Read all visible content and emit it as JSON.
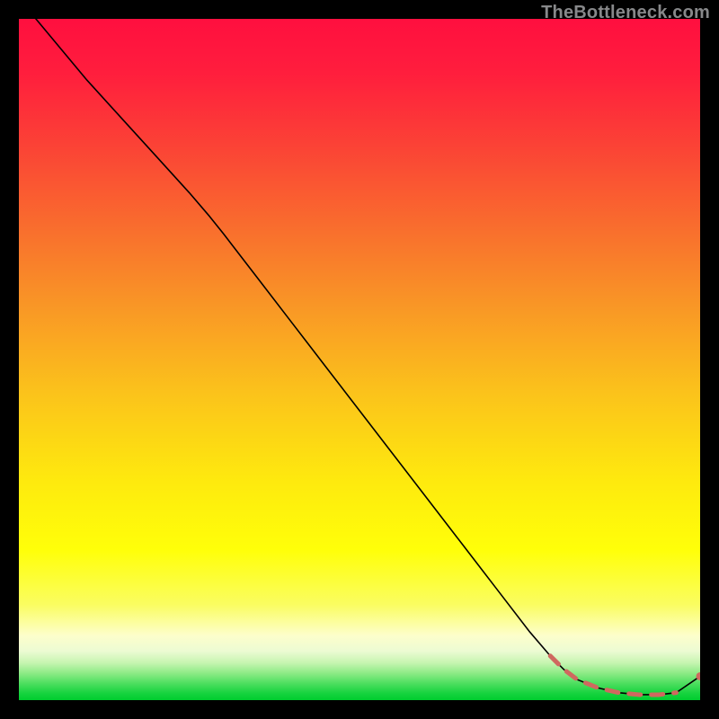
{
  "watermark": "TheBottleneck.com",
  "gradient_stops": [
    {
      "offset": 0.0,
      "color": "#ff0f3f"
    },
    {
      "offset": 0.08,
      "color": "#ff1e3d"
    },
    {
      "offset": 0.18,
      "color": "#fb4036"
    },
    {
      "offset": 0.3,
      "color": "#f96b2e"
    },
    {
      "offset": 0.42,
      "color": "#f99626"
    },
    {
      "offset": 0.55,
      "color": "#fbc31b"
    },
    {
      "offset": 0.68,
      "color": "#feea0e"
    },
    {
      "offset": 0.78,
      "color": "#ffff09"
    },
    {
      "offset": 0.86,
      "color": "#fafd61"
    },
    {
      "offset": 0.905,
      "color": "#fdfecb"
    },
    {
      "offset": 0.928,
      "color": "#ecfbd3"
    },
    {
      "offset": 0.945,
      "color": "#c7f5b1"
    },
    {
      "offset": 0.96,
      "color": "#8feb87"
    },
    {
      "offset": 0.975,
      "color": "#4fdf60"
    },
    {
      "offset": 0.99,
      "color": "#16d33e"
    },
    {
      "offset": 1.0,
      "color": "#00cd2e"
    }
  ],
  "chart_data": {
    "type": "line",
    "title": "",
    "xlabel": "",
    "ylabel": "",
    "xlim": [
      0,
      100
    ],
    "ylim": [
      0,
      100
    ],
    "series": [
      {
        "name": "main-curve",
        "color": "#000000",
        "x": [
          0,
          5,
          10,
          15,
          20,
          25,
          28,
          30,
          35,
          40,
          45,
          50,
          55,
          60,
          65,
          70,
          75,
          78,
          80,
          82,
          85,
          88,
          91,
          94,
          96.5,
          100
        ],
        "y": [
          103,
          97,
          91,
          85.5,
          80,
          74.5,
          71,
          68.5,
          62,
          55.5,
          49,
          42.5,
          36,
          29.5,
          23,
          16.5,
          10,
          6.5,
          4.5,
          3,
          1.8,
          1.1,
          0.8,
          0.8,
          1.1,
          3.5
        ]
      },
      {
        "name": "dashed-tail",
        "style": "dashed",
        "color": "#cf685f",
        "width": 5,
        "x": [
          78,
          80,
          82,
          85,
          88,
          91,
          94,
          96.5
        ],
        "y": [
          6.5,
          4.5,
          3,
          1.8,
          1.1,
          0.8,
          0.8,
          1.1
        ]
      },
      {
        "name": "end-point",
        "style": "marker",
        "color": "#cf685f",
        "x": [
          100
        ],
        "y": [
          3.5
        ]
      }
    ]
  }
}
